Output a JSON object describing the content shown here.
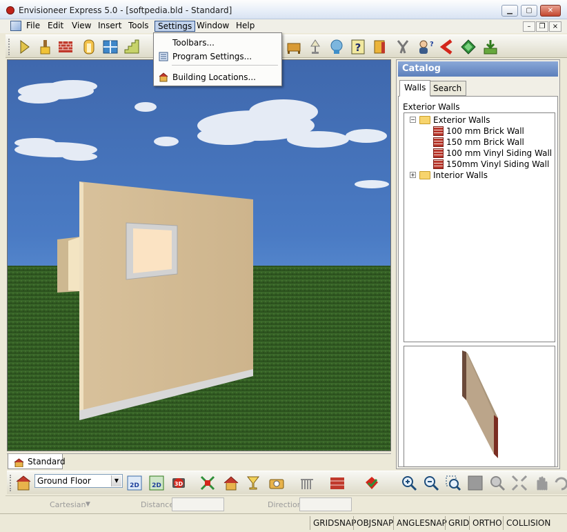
{
  "window": {
    "title": "Envisioneer Express 5.0 - [softpedia.bld - Standard]",
    "minimize": "0",
    "restore": "1",
    "close": "r"
  },
  "menubar": {
    "items": [
      "File",
      "Edit",
      "View",
      "Insert",
      "Tools",
      "Settings",
      "Window",
      "Help"
    ],
    "active": "Settings",
    "mdi_minimize": "–",
    "mdi_restore": "❐",
    "mdi_close": "×"
  },
  "settings_menu": {
    "items": [
      {
        "label": "Toolbars..."
      },
      {
        "label": "Program Settings..."
      },
      {
        "label": "Building Locations..."
      }
    ]
  },
  "toolbar_top": {
    "buttons": [
      "select-arrow-icon",
      "paint-brush-icon",
      "brick-wall-icon",
      "door-icon",
      "window-icon",
      "stair-icon",
      "furniture-icon",
      "lamp-icon",
      "plant-icon",
      "help-icon",
      "book-icon",
      "tools-icon",
      "person-question-icon",
      "arrow-left-icon",
      "gem-icon",
      "download-icon"
    ]
  },
  "document_tabs": {
    "tabs": [
      {
        "label": "Standard"
      }
    ]
  },
  "catalog": {
    "title": "Catalog",
    "tabs": [
      {
        "label": "Walls"
      },
      {
        "label": "Search"
      }
    ],
    "active_tab": "Walls",
    "section_label": "Exterior Walls",
    "tree": [
      {
        "label": "Exterior Walls",
        "type": "folder",
        "expanded": true,
        "children": [
          {
            "label": "100 mm Brick Wall"
          },
          {
            "label": "150 mm Brick Wall"
          },
          {
            "label": "100 mm Vinyl Siding Wall"
          },
          {
            "label": "150mm Vinyl Siding Wall"
          }
        ]
      },
      {
        "label": "Interior Walls",
        "type": "folder",
        "expanded": false
      }
    ],
    "expand_minus": "−",
    "expand_plus": "+"
  },
  "toolbar_bottom": {
    "floor_select": {
      "value": "Ground Floor",
      "arrow": "▼"
    },
    "buttons": [
      "floor-plan-icon",
      "2d-view-icon",
      "2d-plan-icon",
      "3d-camera-icon",
      "3d-orbit-icon",
      "house-icon",
      "glass-icon",
      "camera-icon",
      "railing-icon",
      "wall-section-icon",
      "render-icon",
      "zoom-in-icon",
      "zoom-out-icon",
      "zoom-window-icon",
      "square-icon",
      "zoom-extents-icon",
      "zoom-fit-icon",
      "pan-hand-icon",
      "orbit-icon"
    ],
    "labels": {
      "2d": "2D",
      "2d_plan": "2D",
      "3d": "3D"
    }
  },
  "coordinate_bar": {
    "system": "Cartesian",
    "system_arrow": "▼",
    "distance_label": "Distance",
    "direction_label": "Direction"
  },
  "statusbar": {
    "items": [
      "GRIDSNAP",
      "OBJSNAP",
      "ANGLESNAP",
      "GRID",
      "ORTHO",
      "COLLISION"
    ]
  },
  "colors": {
    "sky": "#4a7bc4",
    "grass": "#2f5a22",
    "wall": "#d9c29e",
    "catalog_header": "#6d8fc8"
  }
}
